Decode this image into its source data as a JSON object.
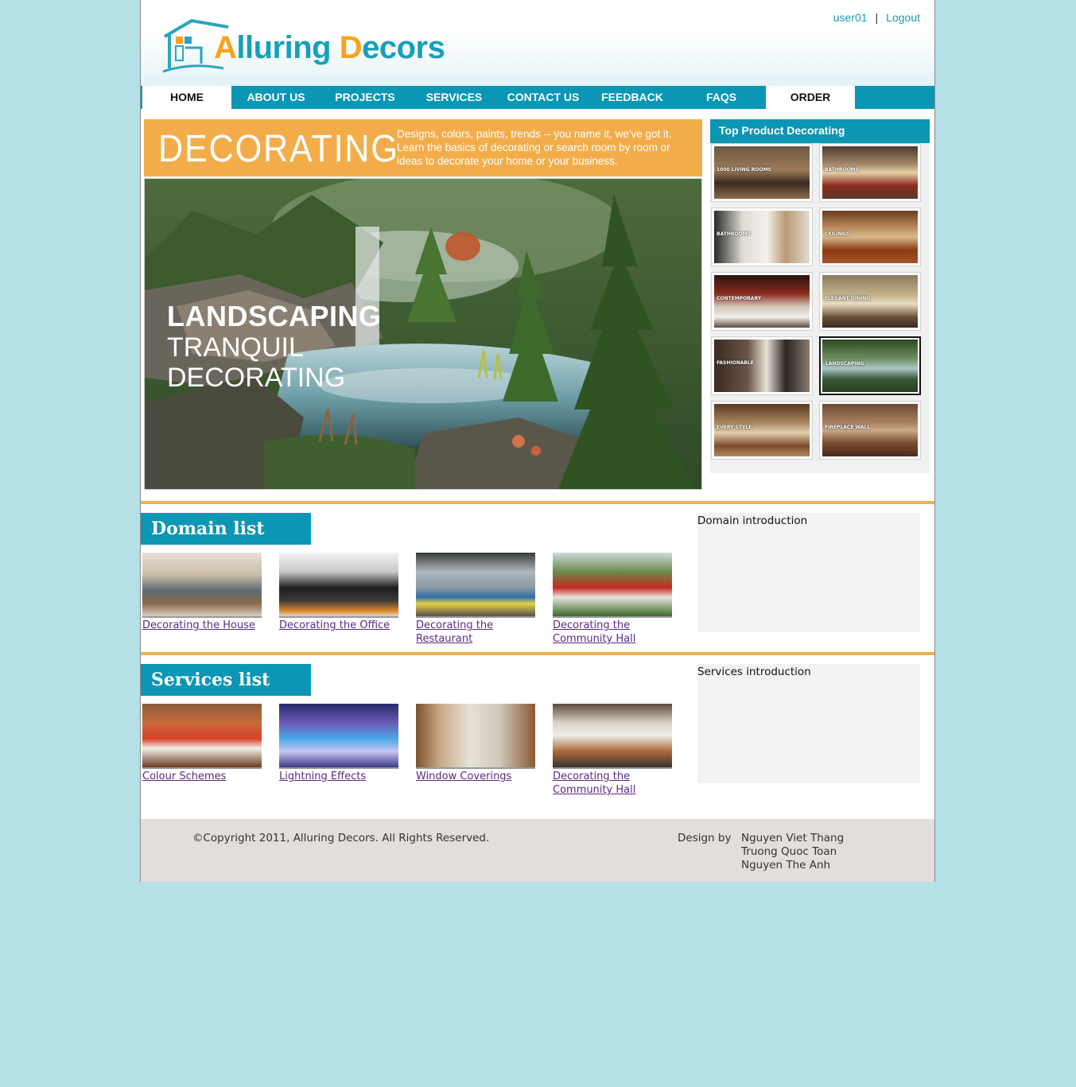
{
  "brand": {
    "logo_first_cap": "A",
    "logo_first_rest": "lluring ",
    "logo_second_cap": "D",
    "logo_second_rest": "ecors",
    "orange": "#f7a31b",
    "teal": "#15a0b8"
  },
  "user": {
    "username": "user01",
    "separator": "|",
    "logout_label": "Logout"
  },
  "nav": {
    "items": [
      {
        "label": "HOME",
        "active": true
      },
      {
        "label": "ABOUT US",
        "active": false
      },
      {
        "label": "PROJECTS",
        "active": false
      },
      {
        "label": "SERVICES",
        "active": false
      },
      {
        "label": "CONTACT US",
        "active": false
      },
      {
        "label": "FEEDBACK",
        "active": false
      },
      {
        "label": "FAQS",
        "active": false
      },
      {
        "label": "ORDER",
        "active": true
      }
    ]
  },
  "banner": {
    "title": "DECORATING",
    "text": "Designs, colors, paints, trends -- you name it, we've got it. Learn the basics of decorating or search room by room or ideas to decorate your home or your business."
  },
  "hero": {
    "line1": "LANDSCAPING",
    "line2": "TRANQUIL",
    "line3": "DECORATING"
  },
  "top_products": {
    "title": "Top Product Decorating",
    "items": [
      {
        "label": "1000 living rooms",
        "selected": false
      },
      {
        "label": "Bathrooms",
        "selected": false
      },
      {
        "label": "Bathrooms",
        "selected": false
      },
      {
        "label": "Ceilings",
        "selected": false
      },
      {
        "label": "Contemporary",
        "selected": false
      },
      {
        "label": "Elegant dining",
        "selected": false
      },
      {
        "label": "Fashionable",
        "selected": false
      },
      {
        "label": "Landscaping",
        "selected": true
      },
      {
        "label": "Every style",
        "selected": false
      },
      {
        "label": "Fireplace wall",
        "selected": false
      }
    ]
  },
  "domain": {
    "title": "Domain list",
    "intro": "Domain introduction",
    "items": [
      {
        "label": "Decorating the House"
      },
      {
        "label": "Decorating the Office"
      },
      {
        "label": "Decorating the Restaurant"
      },
      {
        "label": "Decorating the Community Hall"
      }
    ]
  },
  "services": {
    "title": "Services list",
    "intro": "Services introduction",
    "items": [
      {
        "label": "Colour Schemes"
      },
      {
        "label": "Lightning Effects"
      },
      {
        "label": "Window Coverings"
      },
      {
        "label": "Decorating the Community Hall"
      }
    ]
  },
  "footer": {
    "copyright": "©Copyright 2011, Alluring Decors. All Rights Reserved.",
    "design_by": "Design by",
    "designers": [
      "Nguyen Viet Thang",
      "Truong Quoc Toan",
      "Nguyen The Anh"
    ]
  }
}
